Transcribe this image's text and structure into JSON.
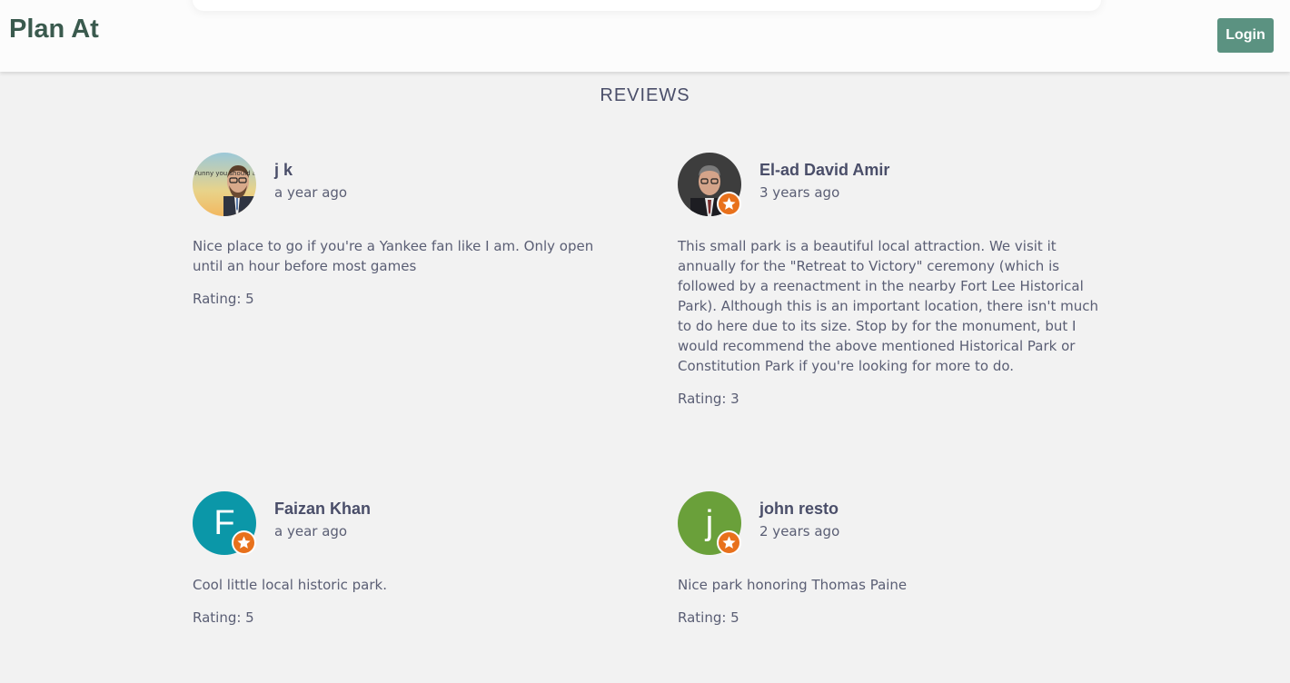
{
  "header": {
    "brand": "Plan At",
    "login_label": "Login"
  },
  "reviews_title": "REVIEWS",
  "reviews": [
    {
      "name": "j k",
      "time": "a year ago",
      "text": "Nice place to go if you're a Yankee fan like I am. Only open until an hour before most games",
      "rating": "Rating: 5",
      "avatar_text": "Funny you should ask!"
    },
    {
      "name": "El-ad David Amir",
      "time": "3 years ago",
      "text": "This small park is a beautiful local attraction. We visit it annually for the \"Retreat to Victory\" ceremony (which is followed by a reenactment in the nearby Fort Lee Historical Park). Although this is an important location, there isn't much to do here due to its size. Stop by for the monument, but I would recommend the above mentioned Historical Park or Constitution Park if you're looking for more to do.",
      "rating": "Rating: 3"
    },
    {
      "name": "Faizan Khan",
      "time": "a year ago",
      "text": "Cool little local historic park.",
      "rating": "Rating: 5",
      "initial": "F"
    },
    {
      "name": "john resto",
      "time": "2 years ago",
      "text": "Nice park honoring Thomas Paine",
      "rating": "Rating: 5",
      "initial": "j"
    }
  ],
  "colors": {
    "brand": "#3a5a4e",
    "login_bg": "#5b9281",
    "badge": "#e8711c",
    "faizan_avatar": "#0b97a8",
    "john_avatar": "#6aa03a"
  }
}
